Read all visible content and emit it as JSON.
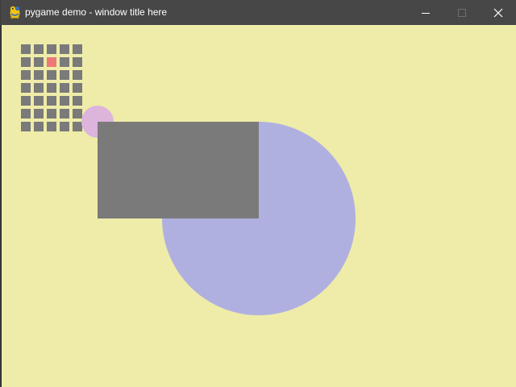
{
  "window": {
    "title": "pygame demo - window title here",
    "controls": {
      "minimize_icon": "minimize-icon",
      "maximize_icon": "maximize-icon",
      "close_icon": "close-icon"
    },
    "colors": {
      "titlebar": "#474747",
      "title_text": "#ffffff",
      "control_glyph": "#ffffff",
      "control_glyph_disabled": "#6e6e6e"
    }
  },
  "scene": {
    "colors": {
      "background": "#eeeca8",
      "grid_tile": "#7a7a7a",
      "grid_tile_highlight": "#ee7878",
      "small_circle": "#dcb4dc",
      "large_circle": "#b0b0e0",
      "rectangle": "#7a7a7a"
    },
    "grid": {
      "rows": 7,
      "cols": 5,
      "highlighted_cell": {
        "row": 1,
        "col": 2
      }
    }
  }
}
